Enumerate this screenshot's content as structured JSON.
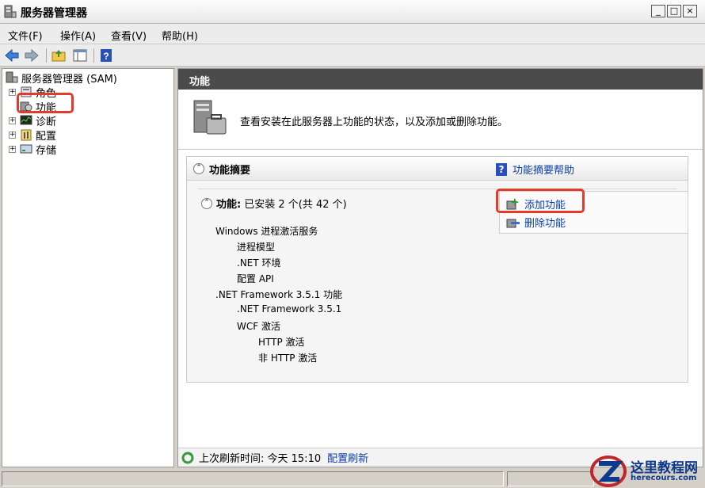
{
  "window": {
    "title": "服务器管理器",
    "buttons": {
      "minimize": "_",
      "maximize": "□",
      "close": "×"
    }
  },
  "menu": [
    "文件(F)",
    "操作(A)",
    "查看(V)",
    "帮助(H)"
  ],
  "tree": {
    "root": "服务器管理器 (SAM)",
    "items": [
      {
        "label": "角色",
        "expander": "+"
      },
      {
        "label": "功能",
        "expander": ""
      },
      {
        "label": "诊断",
        "expander": "+"
      },
      {
        "label": "配置",
        "expander": "+"
      },
      {
        "label": "存储",
        "expander": "+"
      }
    ]
  },
  "main": {
    "header": "功能",
    "intro": "查看安装在此服务器上功能的状态，以及添加或删除功能。",
    "summary": {
      "title": "功能摘要",
      "help_link": "功能摘要帮助",
      "features_label": "功能:",
      "features_status": "已安装 2 个(共 42 个)",
      "collapse_glyph": "⌃",
      "list": [
        "Windows 进程激活服务",
        "进程模型",
        ".NET 环境",
        "配置 API",
        ".NET Framework 3.5.1 功能",
        ".NET Framework 3.5.1",
        "WCF 激活",
        "HTTP 激活",
        "非 HTTP 激活"
      ],
      "actions": {
        "add": "添加功能",
        "remove": "删除功能"
      }
    },
    "status": {
      "text": "上次刷新时间: 今天 15:10",
      "link": "配置刷新"
    }
  },
  "watermark": {
    "title": "这里教程网",
    "url": "herecours.com"
  },
  "colors": {
    "highlight": "#e23b2a",
    "link": "#0b3fa3",
    "header": "#4b4b4b"
  }
}
